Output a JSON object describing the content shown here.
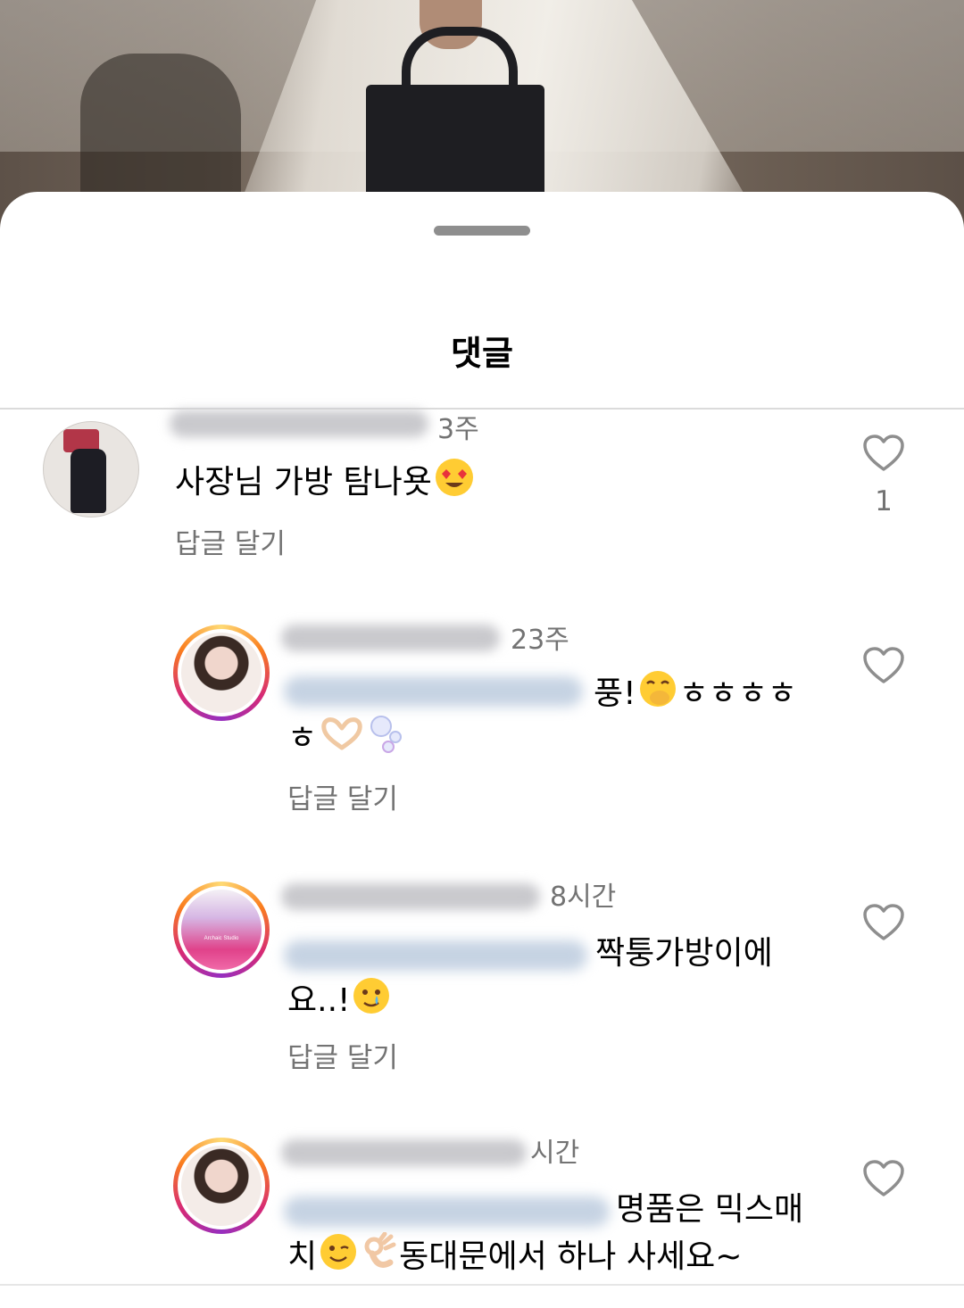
{
  "sheet": {
    "title": "댓글"
  },
  "comments": [
    {
      "time": "3주",
      "text": "사장님 가방 탐나욧",
      "emoji_icons": [
        "heart-eyes-emoji-icon"
      ],
      "reply_label": "답글 달기",
      "like_count": "1"
    },
    {
      "time": "23주",
      "text_line1_after_mention": "풍!",
      "text_line1_trailing": "ㅎㅎㅎㅎ",
      "text_line2": "ㅎ",
      "emoji_icons": [
        "face-with-hand-over-mouth-emoji-icon",
        "heart-hands-emoji-icon",
        "bubbles-emoji-icon"
      ],
      "reply_label": "답글 달기"
    },
    {
      "time": "8시간",
      "avatar_label": "Archaic Studio",
      "text_line1_after_mention": "짝퉁가방이에",
      "text_line2": "요..!",
      "emoji_icons": [
        "face-holding-back-tears-emoji-icon"
      ],
      "reply_label": "답글 달기"
    },
    {
      "time": "시간",
      "text_line1_after_mention": "명품은 믹스매",
      "text_line2_prefix": "치",
      "text_line2": "동대문에서 하나 사세요~",
      "emoji_icons": [
        "winking-face-emoji-icon",
        "ok-hand-emoji-icon"
      ]
    }
  ],
  "colors": {
    "secondary_text": "#737373",
    "story_ring": [
      "#feda75",
      "#fa7e1e",
      "#d62976",
      "#962fbf"
    ]
  }
}
